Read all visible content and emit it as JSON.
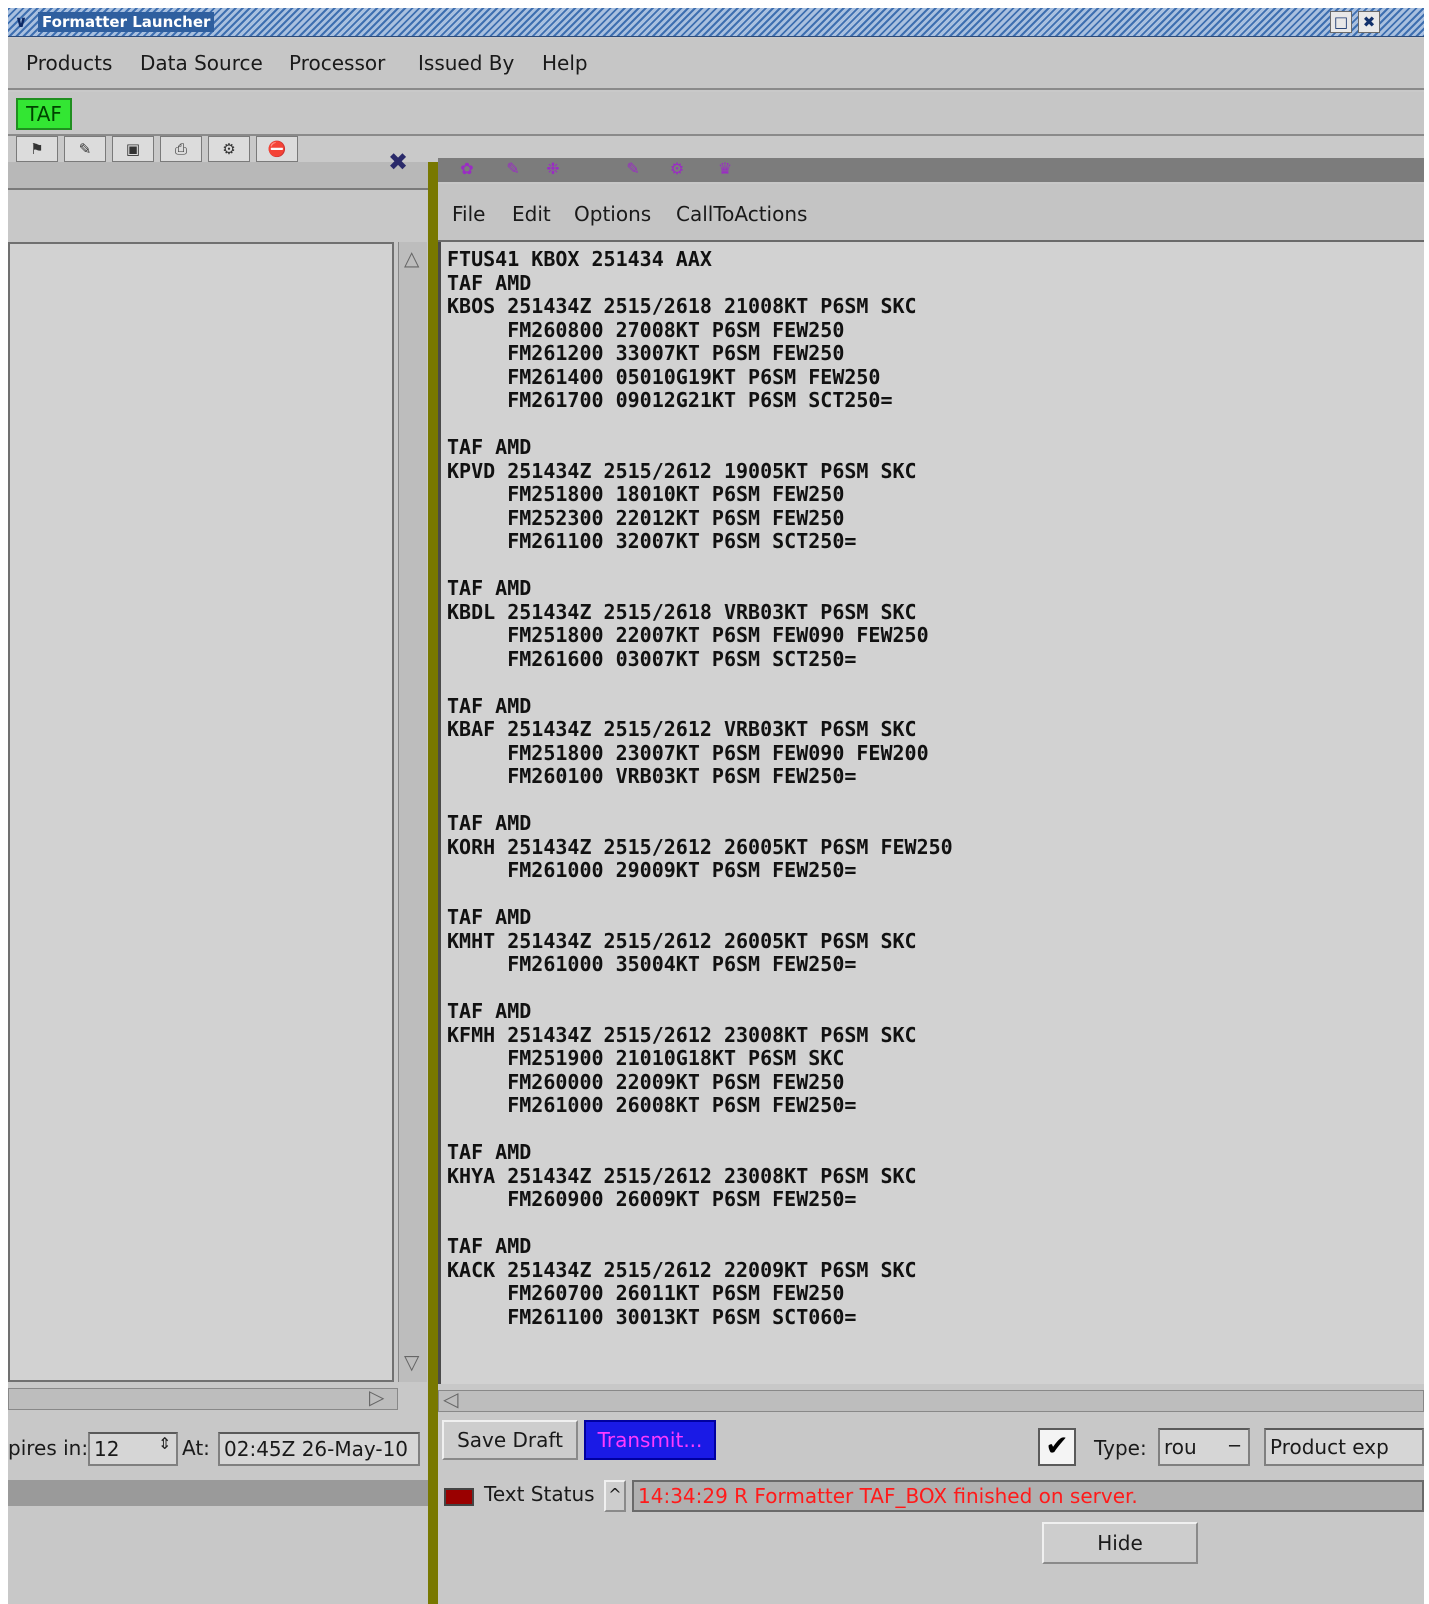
{
  "window": {
    "title": "Formatter Launcher",
    "menu_glyph": "∨",
    "restore_glyph": "□",
    "close_glyph": "✖"
  },
  "launcher_menu": {
    "items": [
      "Products",
      "Data Source",
      "Processor",
      "Issued By",
      "Help"
    ]
  },
  "product_tab": {
    "label": "TAF"
  },
  "colors": {
    "taf_tab": "#33e633",
    "transmit_bg": "#1a1ae6",
    "transmit_text": "#ff3aff",
    "status_text": "#ff1a1a",
    "status_led": "#9a0000"
  },
  "left_panel": {
    "expires_label": "pires in:",
    "expires_value": "12",
    "at_label": "At:",
    "at_value": "02:45Z 26-May-10"
  },
  "editor": {
    "menu": [
      "File",
      "Edit",
      "Options",
      "CallToActions"
    ],
    "text": "FTUS41 KBOX 251434 AAX\nTAF AMD\nKBOS 251434Z 2515/2618 21008KT P6SM SKC\n     FM260800 27008KT P6SM FEW250\n     FM261200 33007KT P6SM FEW250\n     FM261400 05010G19KT P6SM FEW250\n     FM261700 09012G21KT P6SM SCT250=\n\nTAF AMD\nKPVD 251434Z 2515/2612 19005KT P6SM SKC\n     FM251800 18010KT P6SM FEW250\n     FM252300 22012KT P6SM FEW250\n     FM261100 32007KT P6SM SCT250=\n\nTAF AMD\nKBDL 251434Z 2515/2618 VRB03KT P6SM SKC\n     FM251800 22007KT P6SM FEW090 FEW250\n     FM261600 03007KT P6SM SCT250=\n\nTAF AMD\nKBAF 251434Z 2515/2612 VRB03KT P6SM SKC\n     FM251800 23007KT P6SM FEW090 FEW200\n     FM260100 VRB03KT P6SM FEW250=\n\nTAF AMD\nKORH 251434Z 2515/2612 26005KT P6SM FEW250\n     FM261000 29009KT P6SM FEW250=\n\nTAF AMD\nKMHT 251434Z 2515/2612 26005KT P6SM SKC\n     FM261000 35004KT P6SM FEW250=\n\nTAF AMD\nKFMH 251434Z 2515/2612 23008KT P6SM SKC\n     FM251900 21010G18KT P6SM SKC\n     FM260000 22009KT P6SM FEW250\n     FM261000 26008KT P6SM FEW250=\n\nTAF AMD\nKHYA 251434Z 2515/2612 23008KT P6SM SKC\n     FM260900 26009KT P6SM FEW250=\n\nTAF AMD\nKACK 251434Z 2515/2612 22009KT P6SM SKC\n     FM260700 26011KT P6SM FEW250\n     FM261100 30013KT P6SM SCT060="
  },
  "bottom_bar": {
    "save_draft": "Save Draft",
    "transmit": "Transmit...",
    "check_glyph": "✔",
    "type_label": "Type:",
    "type_value": "rou",
    "product_expires": "Product exp",
    "text_status_label": "Text Status",
    "status_message": "14:34:29 R Formatter TAF_BOX finished on server.",
    "hide": "Hide"
  },
  "icons": [
    "dropdown-icon",
    "restore-icon",
    "close-icon",
    "scroll-up-icon",
    "scroll-down-icon",
    "scroll-left-icon",
    "scroll-right-icon",
    "spinner-icon",
    "checkmark-icon",
    "option-menu-icon",
    "status-led-icon",
    "toggle-up-icon"
  ]
}
